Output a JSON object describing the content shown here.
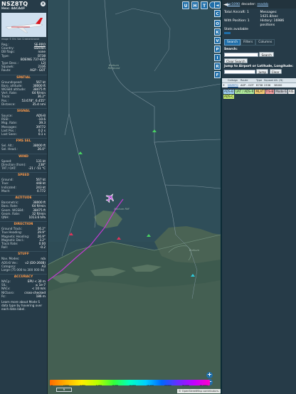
{
  "infoblock": {
    "callsign": "NSZ8TQ",
    "hex": "Hex: 4ACA4F",
    "close_icon": "close-icon",
    "photo_credit": "Image © Eric Van Craenenbroeck",
    "details": [
      {
        "key": "Reg.:",
        "value": "SE-RRO",
        "link": true
      },
      {
        "key": "Country:",
        "value": "Sweden"
      },
      {
        "key": "DB flags:",
        "value": "none"
      },
      {
        "key": "Type:",
        "value": "B738"
      },
      {
        "key": "",
        "value": "BOEING 737-800"
      },
      {
        "key": "Type Desc.:",
        "value": "L2J"
      },
      {
        "key": "Squawk:",
        "value": "2336"
      },
      {
        "key": "Route:",
        "value": "AGP - GOT"
      }
    ],
    "sections": [
      {
        "title": "SPATIAL",
        "rows": [
          {
            "key": "Groundspeed:",
            "value": "567 kt"
          },
          {
            "key": "Baro. altitude:",
            "value": "38000 ft"
          },
          {
            "key": "WGS84 altitude:",
            "value": "38475 ft"
          },
          {
            "key": "Vert. Rate:",
            "value": "64 ft/min"
          },
          {
            "key": "Track:",
            "value": "36.2°"
          },
          {
            "key": "Pos.:",
            "value": "53.678°, 6.455°"
          },
          {
            "key": "Distance:",
            "value": "35.4 nmi"
          }
        ]
      },
      {
        "title": "SIGNAL",
        "rows": [
          {
            "key": "Source:",
            "value": "ADS-B"
          },
          {
            "key": "RSSI:",
            "value": "-10.6"
          },
          {
            "key": "Msg. Rate:",
            "value": "39.3"
          },
          {
            "key": "Messages:",
            "value": "39772"
          },
          {
            "key": "Last Pos.:",
            "value": "0.2 s"
          },
          {
            "key": "Last Seen:",
            "value": "0.1 s"
          }
        ]
      },
      {
        "title": "FMS SEL",
        "rows": [
          {
            "key": "Sel. Alt.:",
            "value": "38000 ft"
          },
          {
            "key": "Sel. Head.:",
            "value": "26.0°"
          }
        ]
      },
      {
        "title": "WIND",
        "rows": [
          {
            "key": "Speed:",
            "value": "131 kt"
          },
          {
            "key": "Direction (from):",
            "value": "238°"
          },
          {
            "key": "TAT / OAT:",
            "value": "-21 / -51 °C"
          }
        ]
      },
      {
        "title": "SPEED",
        "rows": [
          {
            "key": "Ground:",
            "value": "567 kt"
          },
          {
            "key": "True:",
            "value": "448 kt"
          },
          {
            "key": "Indicated:",
            "value": "243 kt"
          },
          {
            "key": "Mach:",
            "value": "0.772"
          }
        ]
      },
      {
        "title": "ALTITUDE",
        "rows": [
          {
            "key": "Barometric:",
            "value": "38000 ft"
          },
          {
            "key": "Baro. Rate:",
            "value": "64 ft/min"
          },
          {
            "key": "Geom. WGS84:",
            "value": "38475 ft"
          },
          {
            "key": "Geom. Rate:",
            "value": "32 ft/min"
          },
          {
            "key": "QNH:",
            "value": "1013.6 hPa"
          }
        ]
      },
      {
        "title": "DIRECTION",
        "rows": [
          {
            "key": "Ground Track:",
            "value": "36.2°"
          },
          {
            "key": "True Heading:",
            "value": "29.9°"
          },
          {
            "key": "Magnetic Heading:",
            "value": "26.9°"
          },
          {
            "key": "Magnetic Decl.:",
            "value": "3.2°"
          },
          {
            "key": "Track Rate:",
            "value": "0.00"
          },
          {
            "key": "Roll:",
            "value": "-0.2"
          }
        ]
      },
      {
        "title": "STUFF",
        "rows": [
          {
            "key": "Nav. Modes:",
            "value": "n/a"
          },
          {
            "key": "ADS-B Ver.:",
            "value": "v2 (DO-260B)"
          },
          {
            "key": "Category:",
            "value": "A3"
          }
        ]
      }
    ],
    "category_note": "Large (75 000 to 300 000 lb)",
    "accuracy_title": "ACCURACY",
    "accuracy": [
      {
        "key": "NACp:",
        "value": "EPU < 30 m"
      },
      {
        "key": "SIL:",
        "value": "≤ 1e-7"
      },
      {
        "key": "NACv:",
        "value": "< 10 m/s"
      },
      {
        "key": "NICbaro:",
        "value": "cross-checked"
      },
      {
        "key": "Rc:",
        "value": "186 m"
      }
    ],
    "footer": "Learn more about Mode S data type by hovering over each data label."
  },
  "map": {
    "labels": [
      "Borkum Riffgrund",
      "Borkum Riff",
      "Borkum"
    ],
    "top_buttons": [
      "U",
      "H",
      "T"
    ],
    "scale_ticks": [
      "0",
      "2,000",
      "4,000",
      "6,000",
      "8,000",
      "10,000",
      "15,000",
      "20,000",
      "30,000",
      "40,000+"
    ],
    "scale_unit": "ft",
    "osm_credit": "© OpenStreetMap contributors.",
    "zoom_in": "+",
    "zoom_out": "−",
    "plane_icon": "plane-icon"
  },
  "toolbar": {
    "buttons": [
      "◄",
      "C",
      "O",
      "K",
      "V",
      "P",
      "I",
      "R",
      "F"
    ]
  },
  "side": {
    "nav_arrow": "◄►",
    "brand": "tar1090",
    "brand2": "decoder:",
    "status": "readsb",
    "total_aircraft": "Total Aircraft: 1",
    "messages": "Messages: 1421.8/sec",
    "with_position": "With Position: 1",
    "history": "History: 16986 positions",
    "stats_available": "Stats available",
    "tabs": [
      "Search",
      "Filters",
      "Columns"
    ],
    "search_label": "Search:",
    "search_button": "Search",
    "clear_search_button": "Clear Search",
    "jump_label": "Jump to Airport or Latitude, Longitude:",
    "jump_button": "Jump",
    "clear_button": "Clear",
    "table_headers": [
      "",
      "Callsign",
      "Route",
      "Type",
      "Squawk",
      "Alt. (ft)",
      ""
    ],
    "table_rows": [
      [
        "✈",
        "NSZ8TQ",
        "AGP - GOT",
        "B738",
        "2336",
        "38000",
        ""
      ]
    ],
    "sources": [
      {
        "label": "ADS-B",
        "color": "#a7d8ff"
      },
      {
        "label": "UAT / ADS-R",
        "color": "#b4f0a0"
      },
      {
        "label": "MLAT",
        "color": "#ffd479"
      },
      {
        "label": "TIS-B",
        "color": "#ffa6a6"
      },
      {
        "label": "Mode-S",
        "color": "#c9ccd3"
      },
      {
        "label": "AIS",
        "color": "#f1f1f1"
      },
      {
        "label": "ADS-C",
        "color": "#c3e86e"
      }
    ]
  }
}
